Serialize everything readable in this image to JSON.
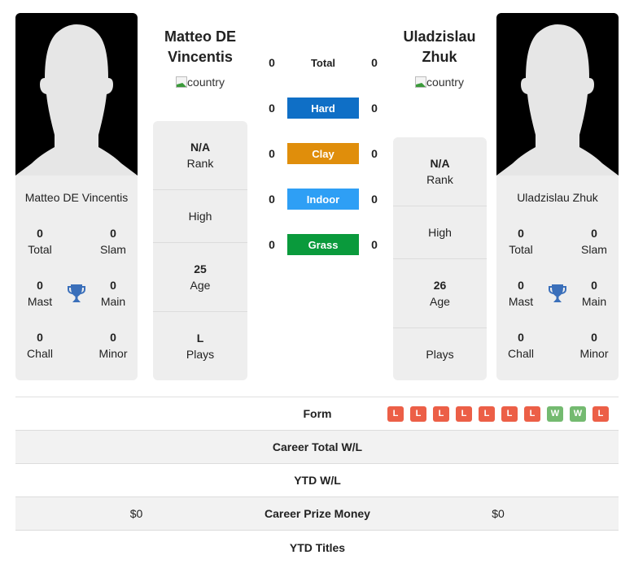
{
  "colors": {
    "hard": "#0f6fc6",
    "clay": "#e08e0b",
    "indoor": "#2e9ff5",
    "grass": "#0a9a3c",
    "loss": "#ec5f47",
    "win": "#74ba70",
    "trophy": "#3a6fba"
  },
  "player1": {
    "name": "Matteo DE Vincentis",
    "header_line1": "Matteo DE",
    "header_line2": "Vincentis",
    "country_alt": "country",
    "titles": {
      "total": {
        "value": "0",
        "label": "Total"
      },
      "slam": {
        "value": "0",
        "label": "Slam"
      },
      "mast": {
        "value": "0",
        "label": "Mast"
      },
      "main": {
        "value": "0",
        "label": "Main"
      },
      "chall": {
        "value": "0",
        "label": "Chall"
      },
      "minor": {
        "value": "0",
        "label": "Minor"
      }
    },
    "info": {
      "rank": {
        "value": "N/A",
        "label": "Rank"
      },
      "high": {
        "value": "",
        "label": "High"
      },
      "age": {
        "value": "25",
        "label": "Age"
      },
      "plays": {
        "value": "L",
        "label": "Plays"
      }
    }
  },
  "player2": {
    "name": "Uladzislau Zhuk",
    "header_line1": "Uladzislau",
    "header_line2": "Zhuk",
    "country_alt": "country",
    "titles": {
      "total": {
        "value": "0",
        "label": "Total"
      },
      "slam": {
        "value": "0",
        "label": "Slam"
      },
      "mast": {
        "value": "0",
        "label": "Mast"
      },
      "main": {
        "value": "0",
        "label": "Main"
      },
      "chall": {
        "value": "0",
        "label": "Chall"
      },
      "minor": {
        "value": "0",
        "label": "Minor"
      }
    },
    "info": {
      "rank": {
        "value": "N/A",
        "label": "Rank"
      },
      "high": {
        "value": "",
        "label": "High"
      },
      "age": {
        "value": "26",
        "label": "Age"
      },
      "plays": {
        "value": "",
        "label": "Plays"
      }
    }
  },
  "surfaces": [
    {
      "label": "Total",
      "p1": "0",
      "p2": "0"
    },
    {
      "label": "Hard",
      "p1": "0",
      "p2": "0"
    },
    {
      "label": "Clay",
      "p1": "0",
      "p2": "0"
    },
    {
      "label": "Indoor",
      "p1": "0",
      "p2": "0"
    },
    {
      "label": "Grass",
      "p1": "0",
      "p2": "0"
    }
  ],
  "table": {
    "form_label": "Form",
    "form": [
      "L",
      "L",
      "L",
      "L",
      "L",
      "L",
      "L",
      "W",
      "W",
      "L"
    ],
    "rows": [
      {
        "label": "Career Total W/L",
        "p1": "",
        "p2": ""
      },
      {
        "label": "YTD W/L",
        "p1": "",
        "p2": ""
      },
      {
        "label": "Career Prize Money",
        "p1": "$0",
        "p2": "$0"
      },
      {
        "label": "YTD Titles",
        "p1": "",
        "p2": ""
      }
    ]
  }
}
